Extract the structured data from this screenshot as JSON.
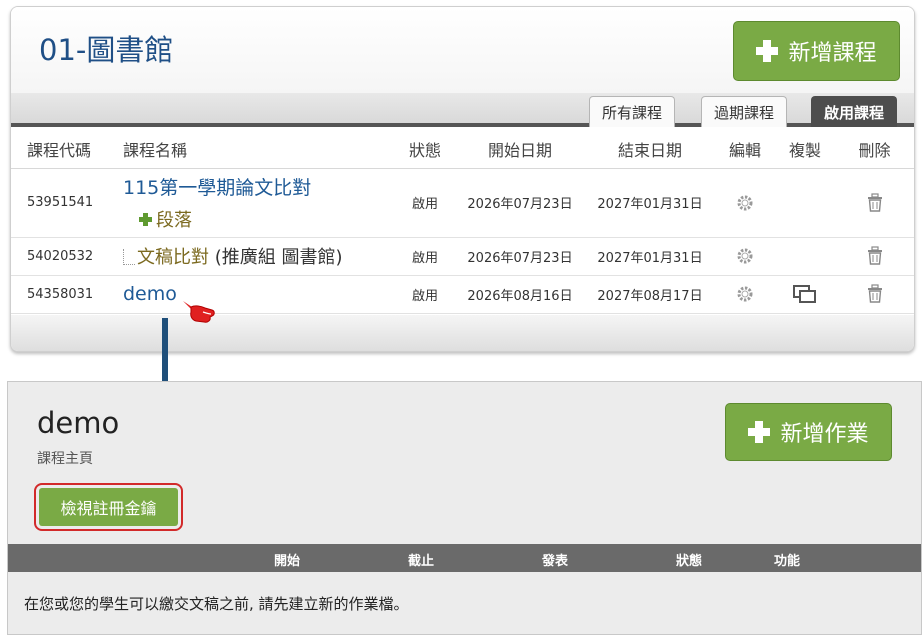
{
  "top": {
    "title": "01-圖書館",
    "add_course_label": "新增課程",
    "tabs": [
      {
        "label": "所有課程"
      },
      {
        "label": "過期課程"
      },
      {
        "label": "啟用課程"
      }
    ],
    "headers": {
      "code": "課程代碼",
      "name": "課程名稱",
      "status": "狀態",
      "start": "開始日期",
      "end": "結束日期",
      "edit": "編輯",
      "copy": "複製",
      "delete": "刪除"
    },
    "rows": [
      {
        "code": "53951541",
        "name": "115第一學期論文比對",
        "section": "段落",
        "status": "啟用",
        "start": "2026年07月23日",
        "end": "2027年01月31日"
      },
      {
        "code": "54020532",
        "name": "文稿比對",
        "name_suffix": " (推廣組 圖書館)",
        "status": "啟用",
        "start": "2026年07月23日",
        "end": "2027年01月31日"
      },
      {
        "code": "54358031",
        "name": "demo",
        "status": "啟用",
        "start": "2026年08月16日",
        "end": "2027年08月17日"
      }
    ]
  },
  "bottom": {
    "course_title": "demo",
    "subtitle": "課程主頁",
    "add_assignment_label": "新增作業",
    "view_key_label": "檢視註冊金鑰",
    "columns": {
      "start": "開始",
      "due": "截止",
      "post": "發表",
      "status": "狀態",
      "actions": "功能"
    },
    "empty_message": "在您或您的學生可以繳交文稿之前, 請先建立新的作業檔。"
  },
  "colors": {
    "green_button": "#7aaa45",
    "title_blue": "#1f4f86",
    "highlight_red": "#d22a2a",
    "dark_header": "#6a6a6a"
  }
}
